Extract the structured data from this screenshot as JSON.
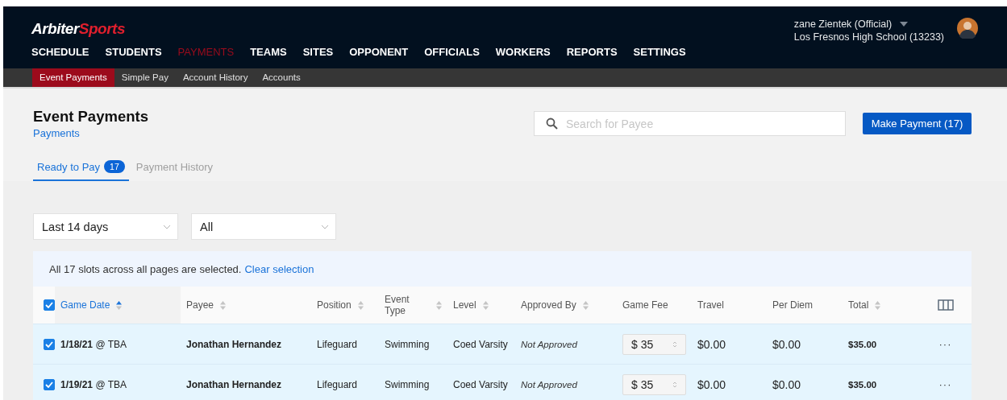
{
  "header": {
    "logo": {
      "first": "Arbiter",
      "second": "Sports"
    },
    "nav": [
      {
        "label": "SCHEDULE",
        "selected": false
      },
      {
        "label": "STUDENTS",
        "selected": false
      },
      {
        "label": "PAYMENTS",
        "selected": true
      },
      {
        "label": "TEAMS",
        "selected": false
      },
      {
        "label": "SITES",
        "selected": false
      },
      {
        "label": "OPPONENT",
        "selected": false
      },
      {
        "label": "OFFICIALS",
        "selected": false
      },
      {
        "label": "WORKERS",
        "selected": false
      },
      {
        "label": "REPORTS",
        "selected": false
      },
      {
        "label": "SETTINGS",
        "selected": false
      }
    ],
    "user": {
      "name": "zane Zientek (Official)",
      "org": "Los Fresnos High School (13233)"
    }
  },
  "subnav": [
    {
      "label": "Event Payments",
      "selected": true
    },
    {
      "label": "Simple Pay",
      "selected": false
    },
    {
      "label": "Account History",
      "selected": false
    },
    {
      "label": "Accounts",
      "selected": false
    }
  ],
  "page": {
    "title": "Event Payments",
    "breadcrumb": "Payments",
    "search": {
      "placeholder": "Search for Payee"
    },
    "action_button": "Make Payment (17)"
  },
  "tabs": [
    {
      "label": "Ready to Pay",
      "badge": "17",
      "selected": true
    },
    {
      "label": "Payment History",
      "selected": false
    }
  ],
  "filters": [
    {
      "value": "Last 14 days"
    },
    {
      "value": "All"
    }
  ],
  "selection_banner": {
    "text": "All 17 slots across all pages are selected.",
    "link": "Clear selection"
  },
  "table": {
    "select_all_checked": true,
    "columns": [
      {
        "label": "Game Date",
        "sortable": true,
        "sorted": true,
        "selected": true
      },
      {
        "label": "Payee",
        "sortable": true,
        "sorted": false,
        "selected": false
      },
      {
        "label": "Position",
        "sortable": true,
        "sorted": false,
        "selected": false
      },
      {
        "label": "Event Type",
        "sortable": true,
        "sorted": false,
        "selected": false
      },
      {
        "label": "Level",
        "sortable": true,
        "sorted": false,
        "selected": false
      },
      {
        "label": "Approved By",
        "sortable": true,
        "sorted": false,
        "selected": false
      },
      {
        "label": "Game Fee",
        "sortable": false,
        "selected": false
      },
      {
        "label": "Travel",
        "sortable": false,
        "selected": false
      },
      {
        "label": "Per Diem",
        "sortable": false,
        "selected": false
      },
      {
        "label": "Total",
        "sortable": true,
        "sorted": false,
        "selected": false
      }
    ],
    "rows": [
      {
        "checked": true,
        "game_date": "**1/18/21** @ TBA",
        "payee": "Jonathan Hernandez",
        "position": "Lifeguard",
        "event_type": "Swimming",
        "level": "Coed Varsity",
        "approved_by": "Not Approved",
        "game_fee": "$ 35",
        "travel": "$0.00",
        "per_diem": "$0.00",
        "total": "$35.00",
        "menu": "···"
      },
      {
        "checked": true,
        "game_date": "**1/19/21** @ TBA",
        "payee": "Jonathan Hernandez",
        "position": "Lifeguard",
        "event_type": "Swimming",
        "level": "Coed Varsity",
        "approved_by": "Not Approved",
        "game_fee": "$ 35",
        "travel": "$0.00",
        "per_diem": "$0.00",
        "total": "$35.00",
        "menu": "···"
      }
    ]
  }
}
